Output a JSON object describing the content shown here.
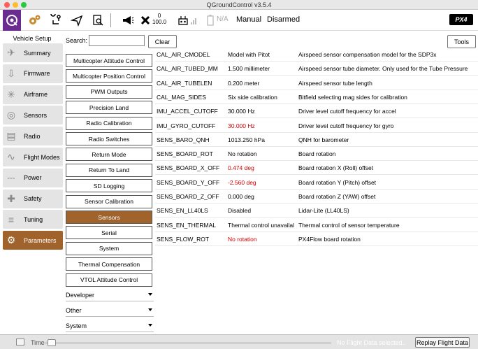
{
  "window": {
    "title": "QGroundControl v3.5.4"
  },
  "toolbar": {
    "icons": [
      "qgc-icon",
      "gear-icon",
      "route-icon",
      "send-icon",
      "analyze-icon",
      "megaphone-icon",
      "satellite-icon",
      "rc-icon",
      "signal-icon",
      "battery-icon"
    ],
    "gps_count": "0",
    "gps_hdop": "100.0",
    "battery": "N/A",
    "flight_mode": "Manual",
    "arm_status": "Disarmed",
    "px4_logo": "PX4"
  },
  "sidebar": {
    "header": "Vehicle Setup",
    "items": [
      {
        "label": "Summary",
        "icon": "summary-icon"
      },
      {
        "label": "Firmware",
        "icon": "firmware-icon"
      },
      {
        "label": "Airframe",
        "icon": "airframe-icon"
      },
      {
        "label": "Sensors",
        "icon": "sensors-icon"
      },
      {
        "label": "Radio",
        "icon": "radio-icon"
      },
      {
        "label": "Flight Modes",
        "icon": "flight-modes-icon"
      },
      {
        "label": "Power",
        "icon": "power-icon"
      },
      {
        "label": "Safety",
        "icon": "safety-icon"
      },
      {
        "label": "Tuning",
        "icon": "tuning-icon"
      },
      {
        "label": "Parameters",
        "icon": "parameters-icon",
        "active": true
      }
    ]
  },
  "search": {
    "label": "Search:",
    "value": "",
    "clear_label": "Clear"
  },
  "tools_label": "Tools",
  "categories": [
    {
      "label": "Multicopter Attitude Control"
    },
    {
      "label": "Multicopter Position Control"
    },
    {
      "label": "PWM Outputs"
    },
    {
      "label": "Precision Land"
    },
    {
      "label": "Radio Calibration"
    },
    {
      "label": "Radio Switches"
    },
    {
      "label": "Return Mode"
    },
    {
      "label": "Return To Land"
    },
    {
      "label": "SD Logging"
    },
    {
      "label": "Sensor Calibration"
    },
    {
      "label": "Sensors",
      "active": true
    },
    {
      "label": "Serial"
    },
    {
      "label": "System"
    },
    {
      "label": "Thermal Compensation"
    },
    {
      "label": "VTOL Attitude Control"
    }
  ],
  "groups": [
    {
      "label": "Developer"
    },
    {
      "label": "Other"
    },
    {
      "label": "System"
    }
  ],
  "parameters": [
    {
      "name": "CAL_AIR_CMODEL",
      "value": "Model with Pitot",
      "desc": "Airspeed sensor compensation model for the SDP3x",
      "modified": false
    },
    {
      "name": "CAL_AIR_TUBED_MM",
      "value": "1.500 millimeter",
      "desc": "Airspeed sensor tube diameter. Only used for the Tube Pressure",
      "modified": false
    },
    {
      "name": "CAL_AIR_TUBELEN",
      "value": "0.200 meter",
      "desc": "Airspeed sensor tube length",
      "modified": false
    },
    {
      "name": "CAL_MAG_SIDES",
      "value": "Six side calibration",
      "desc": "Bitfield selecting mag sides for calibration",
      "modified": false
    },
    {
      "name": "IMU_ACCEL_CUTOFF",
      "value": "30.000 Hz",
      "desc": "Driver level cutoff frequency for accel",
      "modified": false
    },
    {
      "name": "IMU_GYRO_CUTOFF",
      "value": "30.000 Hz",
      "desc": "Driver level cutoff frequency for gyro",
      "modified": true
    },
    {
      "name": "SENS_BARO_QNH",
      "value": "1013.250 hPa",
      "desc": "QNH for barometer",
      "modified": false
    },
    {
      "name": "SENS_BOARD_ROT",
      "value": "No rotation",
      "desc": "Board rotation",
      "modified": false
    },
    {
      "name": "SENS_BOARD_X_OFF",
      "value": "0.474 deg",
      "desc": "Board rotation X (Roll) offset",
      "modified": true
    },
    {
      "name": "SENS_BOARD_Y_OFF",
      "value": "-2.560 deg",
      "desc": "Board rotation Y (Pitch) offset",
      "modified": true
    },
    {
      "name": "SENS_BOARD_Z_OFF",
      "value": "0.000 deg",
      "desc": "Board rotation Z (YAW) offset",
      "modified": false
    },
    {
      "name": "SENS_EN_LL40LS",
      "value": "Disabled",
      "desc": "Lidar-Lite (LL40LS)",
      "modified": false
    },
    {
      "name": "SENS_EN_THERMAL",
      "value": "Thermal control unavailal",
      "desc": "Thermal control of sensor temperature",
      "modified": false
    },
    {
      "name": "SENS_FLOW_ROT",
      "value": "No rotation",
      "desc": "PX4Flow board rotation",
      "modified": true
    }
  ],
  "bottombar": {
    "time_label": "Time",
    "status": "No Flight Data selected..",
    "replay_label": "Replay Flight Data"
  },
  "colors": {
    "accent": "#a0632c",
    "qgc_purple": "#6a2c91",
    "modified": "#d00000"
  }
}
